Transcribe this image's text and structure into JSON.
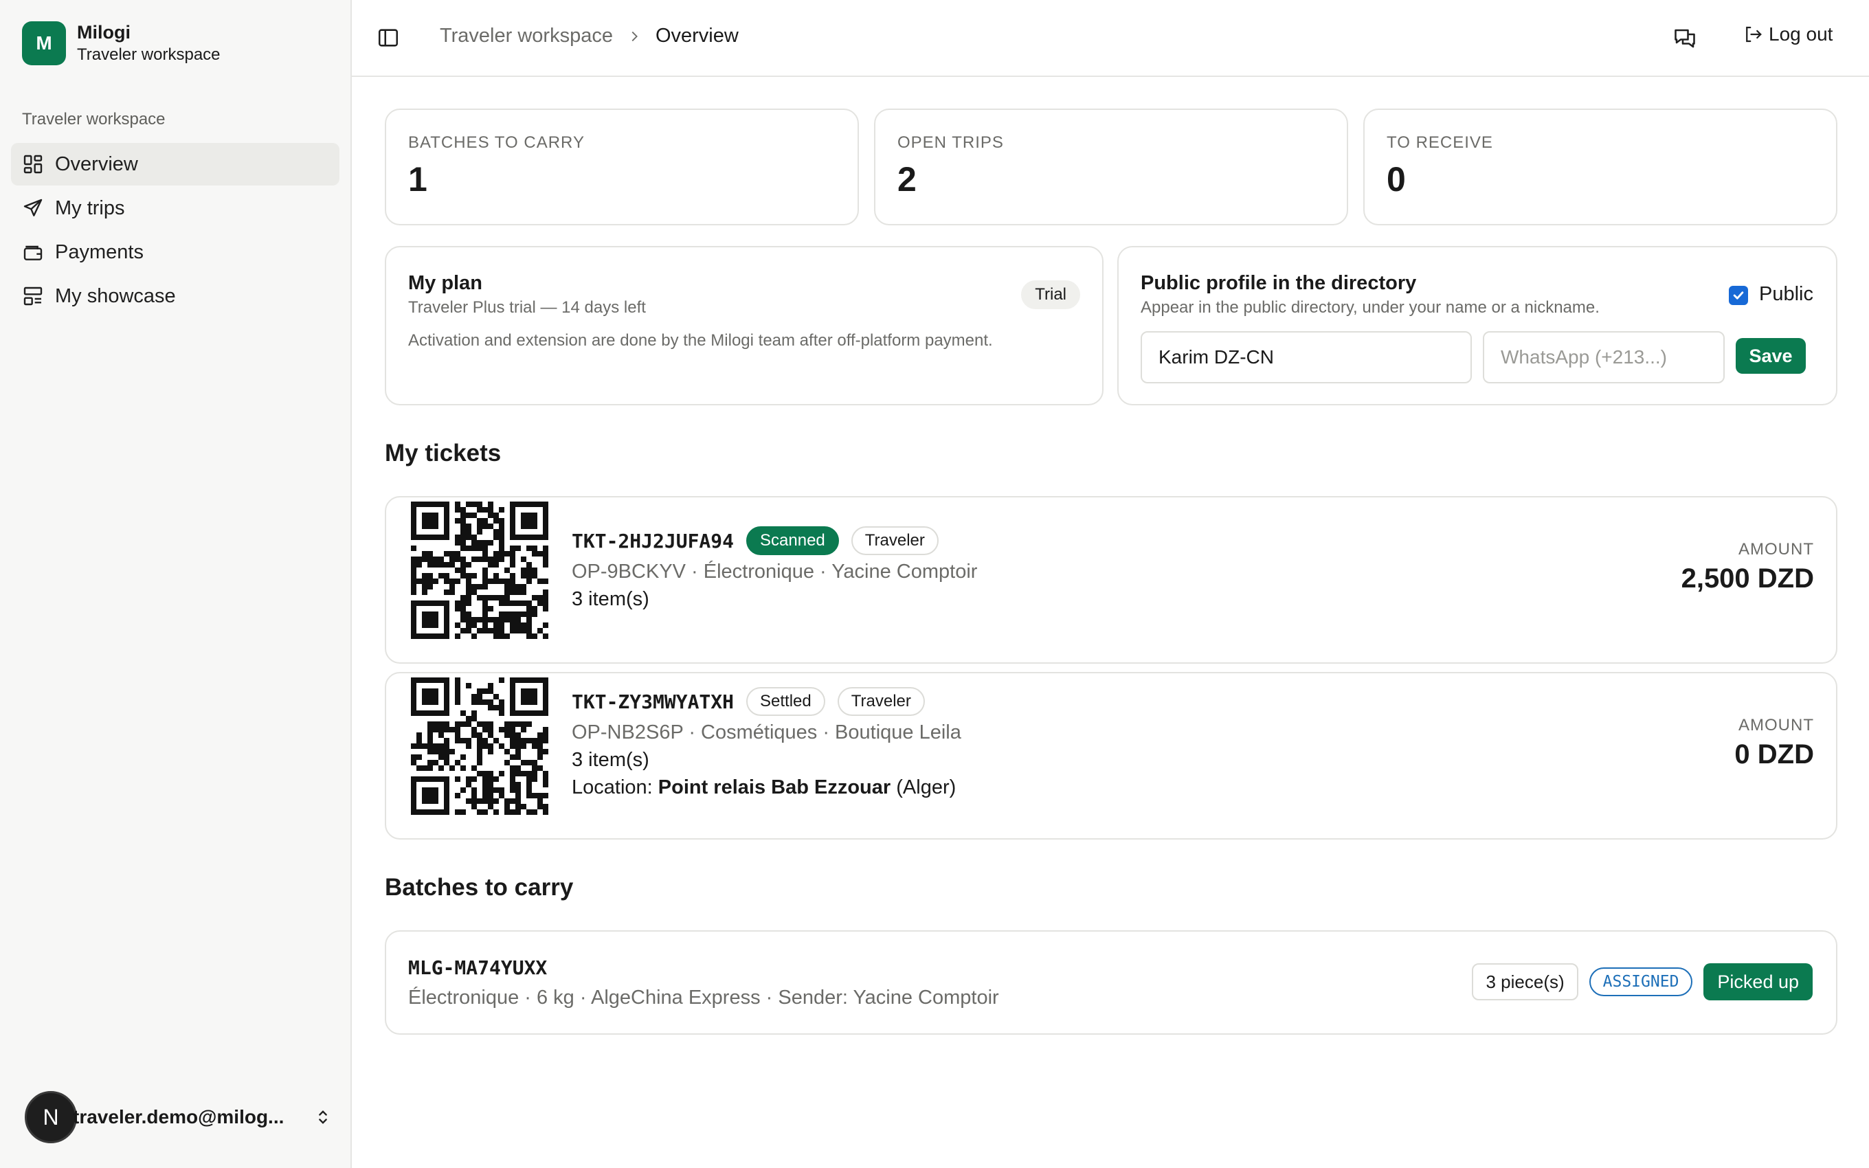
{
  "brand": {
    "logo_letter": "M",
    "name": "Milogi",
    "subtitle": "Traveler workspace"
  },
  "sidebar": {
    "group_label": "Traveler workspace",
    "items": [
      {
        "label": "Overview",
        "icon": "dashboard-icon",
        "active": true
      },
      {
        "label": "My trips",
        "icon": "plane-icon",
        "active": false
      },
      {
        "label": "Payments",
        "icon": "wallet-icon",
        "active": false
      },
      {
        "label": "My showcase",
        "icon": "showcase-icon",
        "active": false
      }
    ],
    "user": {
      "avatar_letter": "N",
      "email": "traveler.demo@milog..."
    }
  },
  "header": {
    "breadcrumb_parent": "Traveler workspace",
    "breadcrumb_current": "Overview",
    "logout_label": "Log out"
  },
  "stats": [
    {
      "label": "BATCHES TO CARRY",
      "value": "1"
    },
    {
      "label": "OPEN TRIPS",
      "value": "2"
    },
    {
      "label": "TO RECEIVE",
      "value": "0"
    }
  ],
  "plan": {
    "title": "My plan",
    "subtitle": "Traveler Plus trial — 14 days left",
    "badge": "Trial",
    "note": "Activation and extension are done by the Milogi team after off-platform payment."
  },
  "profile": {
    "title": "Public profile in the directory",
    "subtitle": "Appear in the public directory, under your name or a nickname.",
    "public_label": "Public",
    "public_checked": true,
    "name_value": "Karim DZ-CN",
    "whatsapp_placeholder": "WhatsApp (+213...)",
    "save_label": "Save"
  },
  "tickets_section": {
    "title": "My tickets",
    "tickets": [
      {
        "id": "TKT-2HJ2JUFA94",
        "status": "Scanned",
        "role": "Traveler",
        "details": "OP-9BCKYV · Électronique · Yacine Comptoir",
        "items": "3 item(s)",
        "amount_label": "AMOUNT",
        "amount": "2,500 DZD"
      },
      {
        "id": "TKT-ZY3MWYATXH",
        "status": "Settled",
        "role": "Traveler",
        "details": "OP-NB2S6P · Cosmétiques · Boutique Leila",
        "items": "3 item(s)",
        "location_label": "Location:",
        "location_name": "Point relais Bab Ezzouar",
        "location_city": "(Alger)",
        "amount_label": "AMOUNT",
        "amount": "0 DZD"
      }
    ]
  },
  "batches_section": {
    "title": "Batches to carry",
    "batch": {
      "id": "MLG-MA74YUXX",
      "details": "Électronique · 6 kg · AlgeChina Express · Sender: Yacine Comptoir",
      "pieces": "3 piece(s)",
      "status": "ASSIGNED",
      "action_label": "Picked up"
    }
  },
  "colors": {
    "accent": "#0b7a50",
    "assigned_blue": "#1d6fb8",
    "checkbox_blue": "#1769d6"
  }
}
